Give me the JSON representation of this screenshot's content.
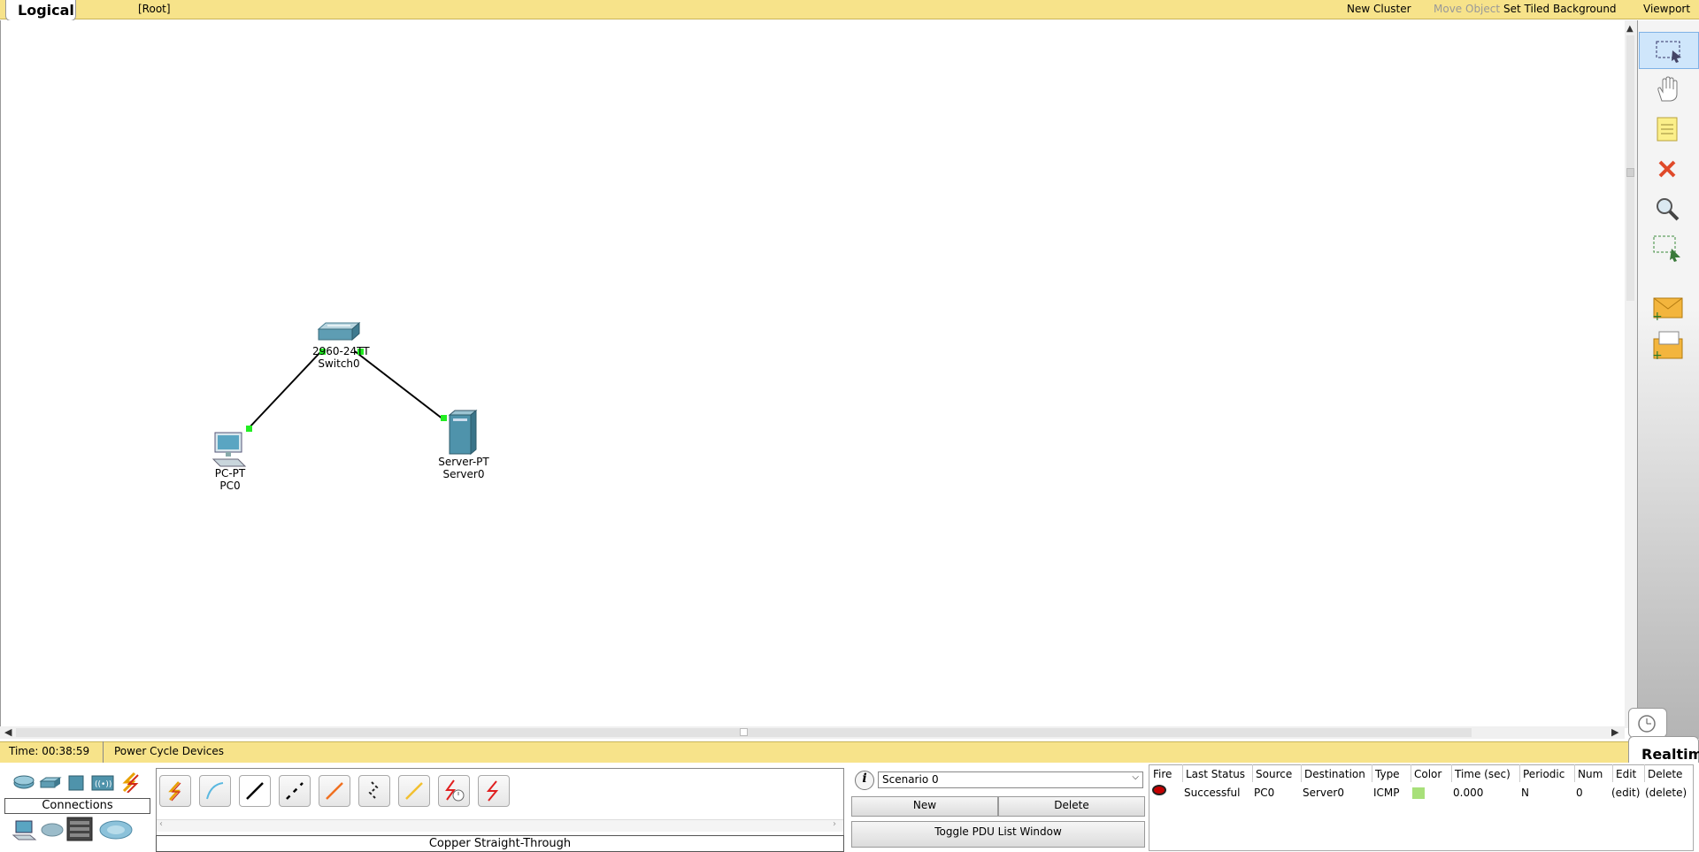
{
  "topbar": {
    "tab": "Logical",
    "breadcrumb": "[Root]",
    "new_cluster": "New Cluster",
    "move_object": "Move Object",
    "set_tiled_background": "Set Tiled Background",
    "viewport": "Viewport"
  },
  "topology": {
    "devices": [
      {
        "model": "2960-24TT",
        "name": "Switch0",
        "icon": "switch-icon"
      },
      {
        "model": "PC-PT",
        "name": "PC0",
        "icon": "pc-icon"
      },
      {
        "model": "Server-PT",
        "name": "Server0",
        "icon": "server-icon"
      }
    ],
    "link_color": "#000000",
    "port_status_color": "#22ee22"
  },
  "right_toolbar": {
    "tools": [
      "select-icon",
      "hand-icon",
      "note-icon",
      "delete-icon",
      "inspect-icon",
      "resize-select-icon",
      "add-simple-pdu-icon",
      "add-complex-pdu-icon"
    ]
  },
  "statusbar": {
    "time": "Time: 00:38:59",
    "power_cycle": "Power Cycle Devices",
    "mode": "Realtime"
  },
  "devices_panel": {
    "category": "Connections"
  },
  "cables": {
    "items": [
      "auto-cable-icon",
      "console-cable-icon",
      "copper-straight-through-icon",
      "copper-cross-over-icon",
      "fiber-icon",
      "phone-cable-icon",
      "coaxial-icon",
      "serial-dce-icon",
      "serial-dte-icon"
    ],
    "selected_name": "Copper Straight-Through"
  },
  "scenario": {
    "selected": "Scenario 0",
    "new": "New",
    "delete": "Delete",
    "toggle": "Toggle PDU List Window"
  },
  "pdu_table": {
    "headers": [
      "Fire",
      "Last Status",
      "Source",
      "Destination",
      "Type",
      "Color",
      "Time (sec)",
      "Periodic",
      "Num",
      "Edit",
      "Delete"
    ],
    "rows": [
      {
        "last_status": "Successful",
        "source": "PC0",
        "destination": "Server0",
        "type": "ICMP",
        "color": "#a8e07a",
        "time": "0.000",
        "periodic": "N",
        "num": "0",
        "edit": "(edit)",
        "delete": "(delete)"
      }
    ]
  },
  "colors": {
    "bar_yellow": "#f7e38a",
    "accent_blue": "#cfe6fb"
  }
}
